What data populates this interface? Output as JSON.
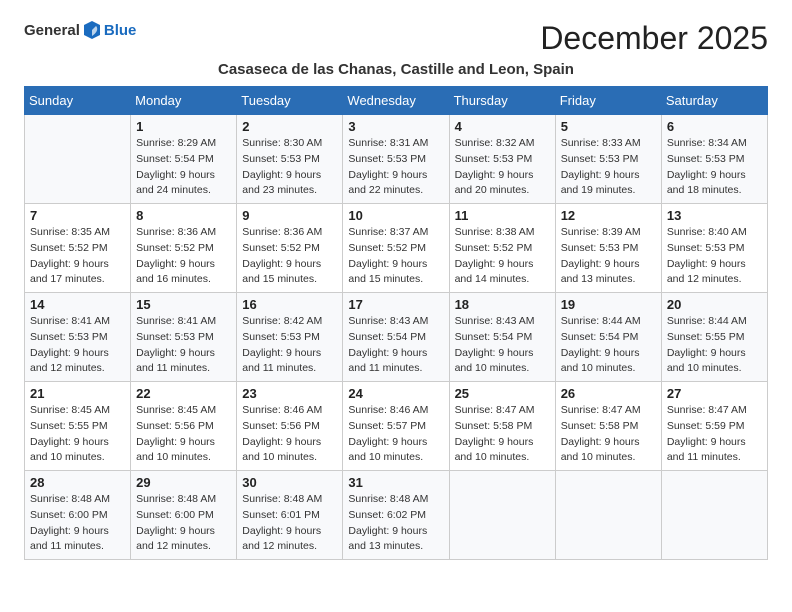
{
  "logo": {
    "general": "General",
    "blue": "Blue"
  },
  "title": "December 2025",
  "subtitle": "Casaseca de las Chanas, Castille and Leon, Spain",
  "weekdays": [
    "Sunday",
    "Monday",
    "Tuesday",
    "Wednesday",
    "Thursday",
    "Friday",
    "Saturday"
  ],
  "weeks": [
    [
      {
        "day": "",
        "sunrise": "",
        "sunset": "",
        "daylight": ""
      },
      {
        "day": "1",
        "sunrise": "Sunrise: 8:29 AM",
        "sunset": "Sunset: 5:54 PM",
        "daylight": "Daylight: 9 hours and 24 minutes."
      },
      {
        "day": "2",
        "sunrise": "Sunrise: 8:30 AM",
        "sunset": "Sunset: 5:53 PM",
        "daylight": "Daylight: 9 hours and 23 minutes."
      },
      {
        "day": "3",
        "sunrise": "Sunrise: 8:31 AM",
        "sunset": "Sunset: 5:53 PM",
        "daylight": "Daylight: 9 hours and 22 minutes."
      },
      {
        "day": "4",
        "sunrise": "Sunrise: 8:32 AM",
        "sunset": "Sunset: 5:53 PM",
        "daylight": "Daylight: 9 hours and 20 minutes."
      },
      {
        "day": "5",
        "sunrise": "Sunrise: 8:33 AM",
        "sunset": "Sunset: 5:53 PM",
        "daylight": "Daylight: 9 hours and 19 minutes."
      },
      {
        "day": "6",
        "sunrise": "Sunrise: 8:34 AM",
        "sunset": "Sunset: 5:53 PM",
        "daylight": "Daylight: 9 hours and 18 minutes."
      }
    ],
    [
      {
        "day": "7",
        "sunrise": "Sunrise: 8:35 AM",
        "sunset": "Sunset: 5:52 PM",
        "daylight": "Daylight: 9 hours and 17 minutes."
      },
      {
        "day": "8",
        "sunrise": "Sunrise: 8:36 AM",
        "sunset": "Sunset: 5:52 PM",
        "daylight": "Daylight: 9 hours and 16 minutes."
      },
      {
        "day": "9",
        "sunrise": "Sunrise: 8:36 AM",
        "sunset": "Sunset: 5:52 PM",
        "daylight": "Daylight: 9 hours and 15 minutes."
      },
      {
        "day": "10",
        "sunrise": "Sunrise: 8:37 AM",
        "sunset": "Sunset: 5:52 PM",
        "daylight": "Daylight: 9 hours and 15 minutes."
      },
      {
        "day": "11",
        "sunrise": "Sunrise: 8:38 AM",
        "sunset": "Sunset: 5:52 PM",
        "daylight": "Daylight: 9 hours and 14 minutes."
      },
      {
        "day": "12",
        "sunrise": "Sunrise: 8:39 AM",
        "sunset": "Sunset: 5:53 PM",
        "daylight": "Daylight: 9 hours and 13 minutes."
      },
      {
        "day": "13",
        "sunrise": "Sunrise: 8:40 AM",
        "sunset": "Sunset: 5:53 PM",
        "daylight": "Daylight: 9 hours and 12 minutes."
      }
    ],
    [
      {
        "day": "14",
        "sunrise": "Sunrise: 8:41 AM",
        "sunset": "Sunset: 5:53 PM",
        "daylight": "Daylight: 9 hours and 12 minutes."
      },
      {
        "day": "15",
        "sunrise": "Sunrise: 8:41 AM",
        "sunset": "Sunset: 5:53 PM",
        "daylight": "Daylight: 9 hours and 11 minutes."
      },
      {
        "day": "16",
        "sunrise": "Sunrise: 8:42 AM",
        "sunset": "Sunset: 5:53 PM",
        "daylight": "Daylight: 9 hours and 11 minutes."
      },
      {
        "day": "17",
        "sunrise": "Sunrise: 8:43 AM",
        "sunset": "Sunset: 5:54 PM",
        "daylight": "Daylight: 9 hours and 11 minutes."
      },
      {
        "day": "18",
        "sunrise": "Sunrise: 8:43 AM",
        "sunset": "Sunset: 5:54 PM",
        "daylight": "Daylight: 9 hours and 10 minutes."
      },
      {
        "day": "19",
        "sunrise": "Sunrise: 8:44 AM",
        "sunset": "Sunset: 5:54 PM",
        "daylight": "Daylight: 9 hours and 10 minutes."
      },
      {
        "day": "20",
        "sunrise": "Sunrise: 8:44 AM",
        "sunset": "Sunset: 5:55 PM",
        "daylight": "Daylight: 9 hours and 10 minutes."
      }
    ],
    [
      {
        "day": "21",
        "sunrise": "Sunrise: 8:45 AM",
        "sunset": "Sunset: 5:55 PM",
        "daylight": "Daylight: 9 hours and 10 minutes."
      },
      {
        "day": "22",
        "sunrise": "Sunrise: 8:45 AM",
        "sunset": "Sunset: 5:56 PM",
        "daylight": "Daylight: 9 hours and 10 minutes."
      },
      {
        "day": "23",
        "sunrise": "Sunrise: 8:46 AM",
        "sunset": "Sunset: 5:56 PM",
        "daylight": "Daylight: 9 hours and 10 minutes."
      },
      {
        "day": "24",
        "sunrise": "Sunrise: 8:46 AM",
        "sunset": "Sunset: 5:57 PM",
        "daylight": "Daylight: 9 hours and 10 minutes."
      },
      {
        "day": "25",
        "sunrise": "Sunrise: 8:47 AM",
        "sunset": "Sunset: 5:58 PM",
        "daylight": "Daylight: 9 hours and 10 minutes."
      },
      {
        "day": "26",
        "sunrise": "Sunrise: 8:47 AM",
        "sunset": "Sunset: 5:58 PM",
        "daylight": "Daylight: 9 hours and 10 minutes."
      },
      {
        "day": "27",
        "sunrise": "Sunrise: 8:47 AM",
        "sunset": "Sunset: 5:59 PM",
        "daylight": "Daylight: 9 hours and 11 minutes."
      }
    ],
    [
      {
        "day": "28",
        "sunrise": "Sunrise: 8:48 AM",
        "sunset": "Sunset: 6:00 PM",
        "daylight": "Daylight: 9 hours and 11 minutes."
      },
      {
        "day": "29",
        "sunrise": "Sunrise: 8:48 AM",
        "sunset": "Sunset: 6:00 PM",
        "daylight": "Daylight: 9 hours and 12 minutes."
      },
      {
        "day": "30",
        "sunrise": "Sunrise: 8:48 AM",
        "sunset": "Sunset: 6:01 PM",
        "daylight": "Daylight: 9 hours and 12 minutes."
      },
      {
        "day": "31",
        "sunrise": "Sunrise: 8:48 AM",
        "sunset": "Sunset: 6:02 PM",
        "daylight": "Daylight: 9 hours and 13 minutes."
      },
      {
        "day": "",
        "sunrise": "",
        "sunset": "",
        "daylight": ""
      },
      {
        "day": "",
        "sunrise": "",
        "sunset": "",
        "daylight": ""
      },
      {
        "day": "",
        "sunrise": "",
        "sunset": "",
        "daylight": ""
      }
    ]
  ]
}
